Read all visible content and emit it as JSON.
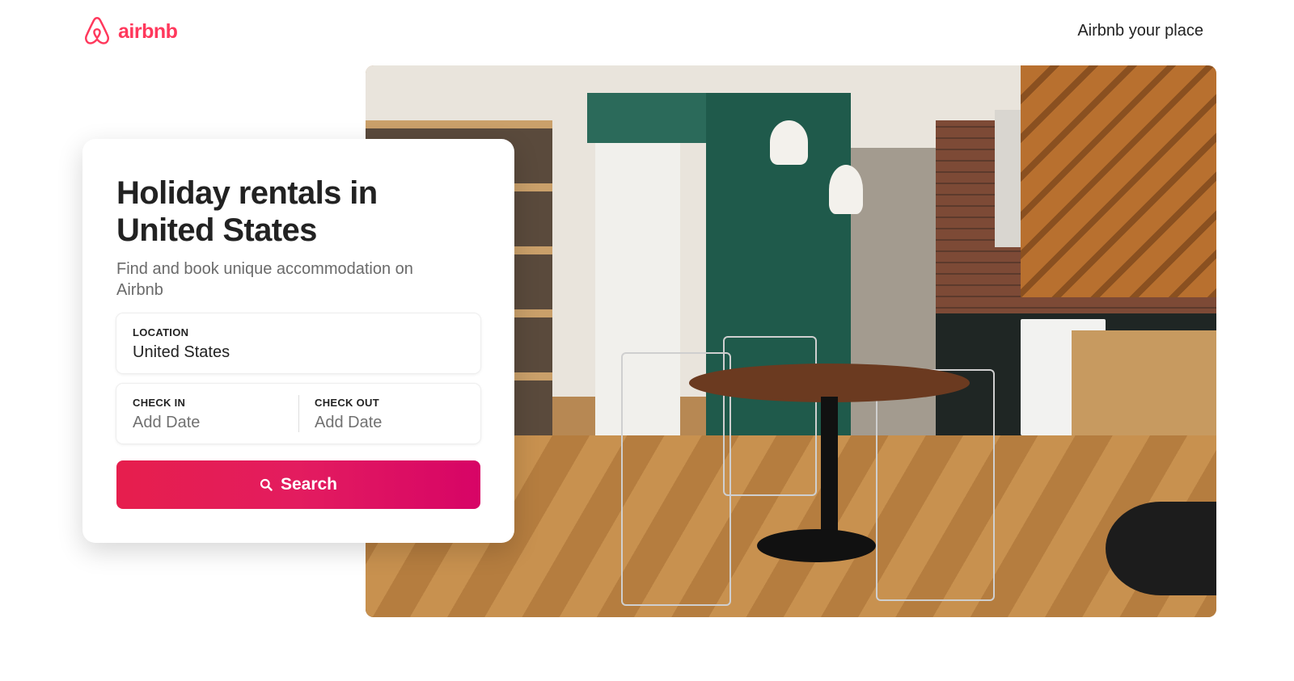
{
  "brand": {
    "name": "airbnb",
    "color": "#FF385C"
  },
  "header": {
    "host_link": "Airbnb your place"
  },
  "hero": {
    "title": "Holiday rentals in United States",
    "subtitle": "Find and book unique accommodation on Airbnb"
  },
  "form": {
    "location": {
      "label": "LOCATION",
      "value": "United States"
    },
    "check_in": {
      "label": "CHECK IN",
      "placeholder": "Add Date"
    },
    "check_out": {
      "label": "CHECK OUT",
      "placeholder": "Add Date"
    },
    "search_label": "Search",
    "search_icon": "search-icon",
    "button_gradient": [
      "#E61E4D",
      "#E31C5F",
      "#D70466"
    ]
  }
}
